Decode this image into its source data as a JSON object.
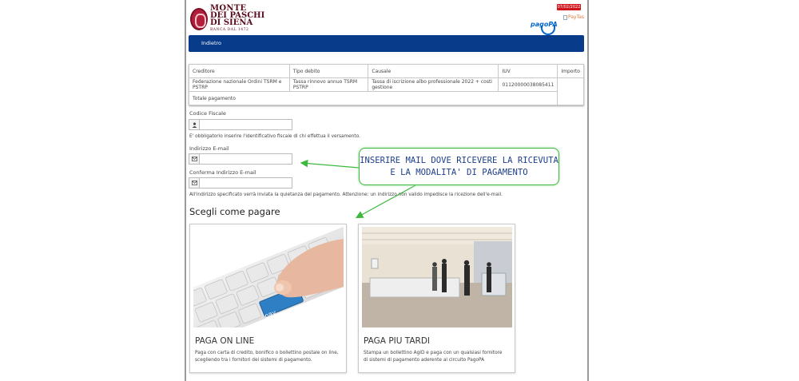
{
  "header": {
    "brand": {
      "line1": "MONTE",
      "line2": "DEI PASCHI",
      "line3": "DI SIENA",
      "line4": "BANCA DAL 1472"
    },
    "date_badge": "07/02/2022",
    "pagopa_label": "pagoPA",
    "paytas_alt": "PayTas"
  },
  "nav": {
    "back_label": "Indietro"
  },
  "table": {
    "headers": [
      "Creditore",
      "Tipo debito",
      "Causale",
      "IUV",
      "Importo"
    ],
    "row": [
      "Federazione nazionale Ordini TSRM e PSTRP",
      "Tassa rinnovo annuo TSRM PSTRP",
      "Tassa di iscrizione albo professionale 2022 + costi gestione",
      "01120000038085411",
      ""
    ],
    "total_label": "Totale pagamento"
  },
  "form": {
    "codice_fiscale_label": "Codice Fiscale",
    "codice_fiscale_value": "",
    "codice_fiscale_note": "E' obbligatorio inserire l'identificativo fiscale di chi effettua il versamento.",
    "email_label": "Indirizzo E-mail",
    "email_value": "",
    "confirm_email_label": "Conferma Indirizzo E-mail",
    "confirm_email_value": "",
    "email_note": "All'indirizzo specificato verrà inviata la quietanza del pagamento. Attenzione: un indirizzo non valido impedisce la ricezione dell'e-mail."
  },
  "payment": {
    "section_title": "Scegli come pagare",
    "options": [
      {
        "title": "PAGA ON LINE",
        "desc": "Paga con carta di credito, bonifico o bollettino postale on line, scegliendo tra i fornitori dei sistemi di pagamento.",
        "key_text": "pay"
      },
      {
        "title": "PAGA PIU TARDI",
        "desc": "Stampa un bollettino AgID e paga con un qualsiasi fornitore di sistemi di pagamento aderente al circuito PagoPA"
      }
    ]
  },
  "annotation": {
    "line1": "INSERIRE MAIL DOVE RICEVERE LA RICEVUTA",
    "line2": "E LA MODALITA' DI PAGAMENTO"
  },
  "colors": {
    "nav": "#083b8a",
    "badge": "#d0141c",
    "annotation_border": "#3fb83f",
    "annotation_text": "#1d3f8a"
  }
}
